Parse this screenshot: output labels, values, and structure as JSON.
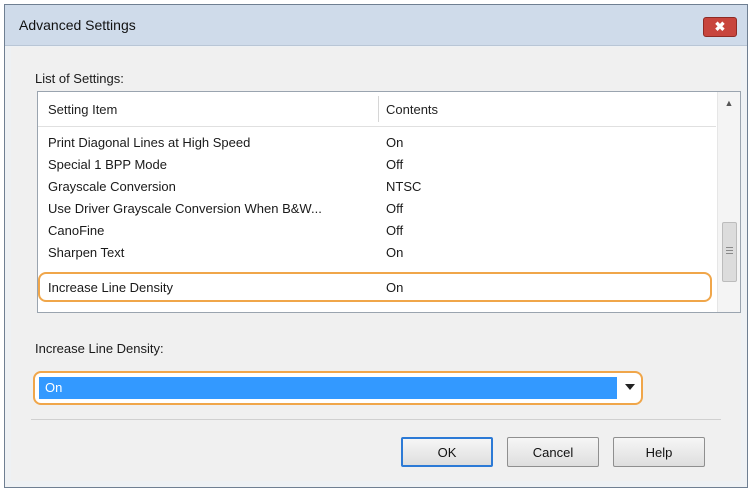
{
  "window": {
    "title": "Advanced Settings",
    "close_glyph": "✖"
  },
  "list": {
    "label": "List of Settings:",
    "columns": [
      "Setting Item",
      "Contents"
    ],
    "rows": [
      {
        "name": "Print Diagonal Lines at High Speed",
        "value": "On"
      },
      {
        "name": "Special 1 BPP Mode",
        "value": "Off"
      },
      {
        "name": "Grayscale Conversion",
        "value": "NTSC"
      },
      {
        "name": "Use Driver Grayscale Conversion When B&W...",
        "value": "Off"
      },
      {
        "name": "CanoFine",
        "value": "Off"
      },
      {
        "name": "Sharpen Text",
        "value": "On"
      }
    ],
    "selected_row": {
      "name": "Increase Line Density",
      "value": "On"
    }
  },
  "setting": {
    "label": "Increase Line Density:",
    "selected_value": "On"
  },
  "buttons": {
    "ok": "OK",
    "cancel": "Cancel",
    "help": "Help"
  },
  "icons": {
    "close": "close-icon",
    "dropdown": "chevron-down-icon",
    "scroll_up": "arrow-up-icon",
    "grip": "grip-icon"
  },
  "colors": {
    "highlight": "#f0a64a",
    "selection": "#3399ff",
    "close": "#c8453d"
  }
}
